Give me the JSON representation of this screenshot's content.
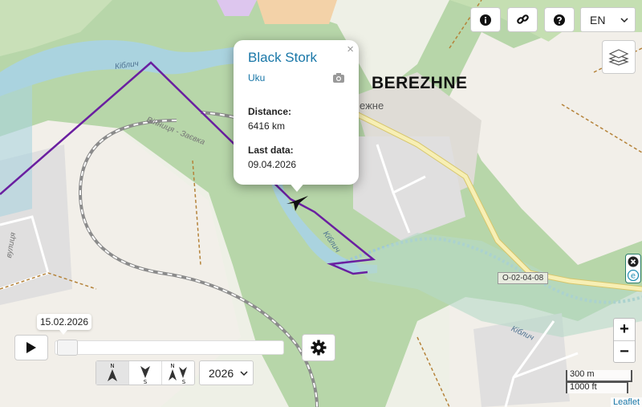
{
  "map": {
    "town_label": "BEREZHNE",
    "town_label_small": "ежне",
    "river_labels": [
      "Кіблич",
      "Кіблич",
      "Кіблич"
    ],
    "road_labels": [
      "Вінниця - Заєвка",
      "вулиця"
    ],
    "road_badge": "O-02-04-08",
    "colors": {
      "track": "#6a1fa0",
      "water": "#aad3df",
      "forest": "#add19e",
      "land": "#f2efe9"
    }
  },
  "popup": {
    "title": "Black Stork",
    "subtitle": "Uku",
    "close": "×",
    "distance_label": "Distance:",
    "distance_value": "6416 km",
    "last_label": "Last data:",
    "last_value": "09.04.2026"
  },
  "top_controls": {
    "info_icon": "info-icon",
    "link_icon": "link-icon",
    "help_icon": "help-icon",
    "language": "EN"
  },
  "playback": {
    "date_tooltip": "15.02.2026",
    "progress": 0.0,
    "year": "2026",
    "directions": [
      {
        "top": "N",
        "bottom": ""
      },
      {
        "top": "",
        "bottom": "S"
      },
      {
        "top": "N",
        "bottom": "S"
      }
    ]
  },
  "zoom": {
    "in": "+",
    "out": "−"
  },
  "scale": {
    "metric": "300 m",
    "imperial": "1000 ft"
  },
  "attribution": "Leaflet"
}
